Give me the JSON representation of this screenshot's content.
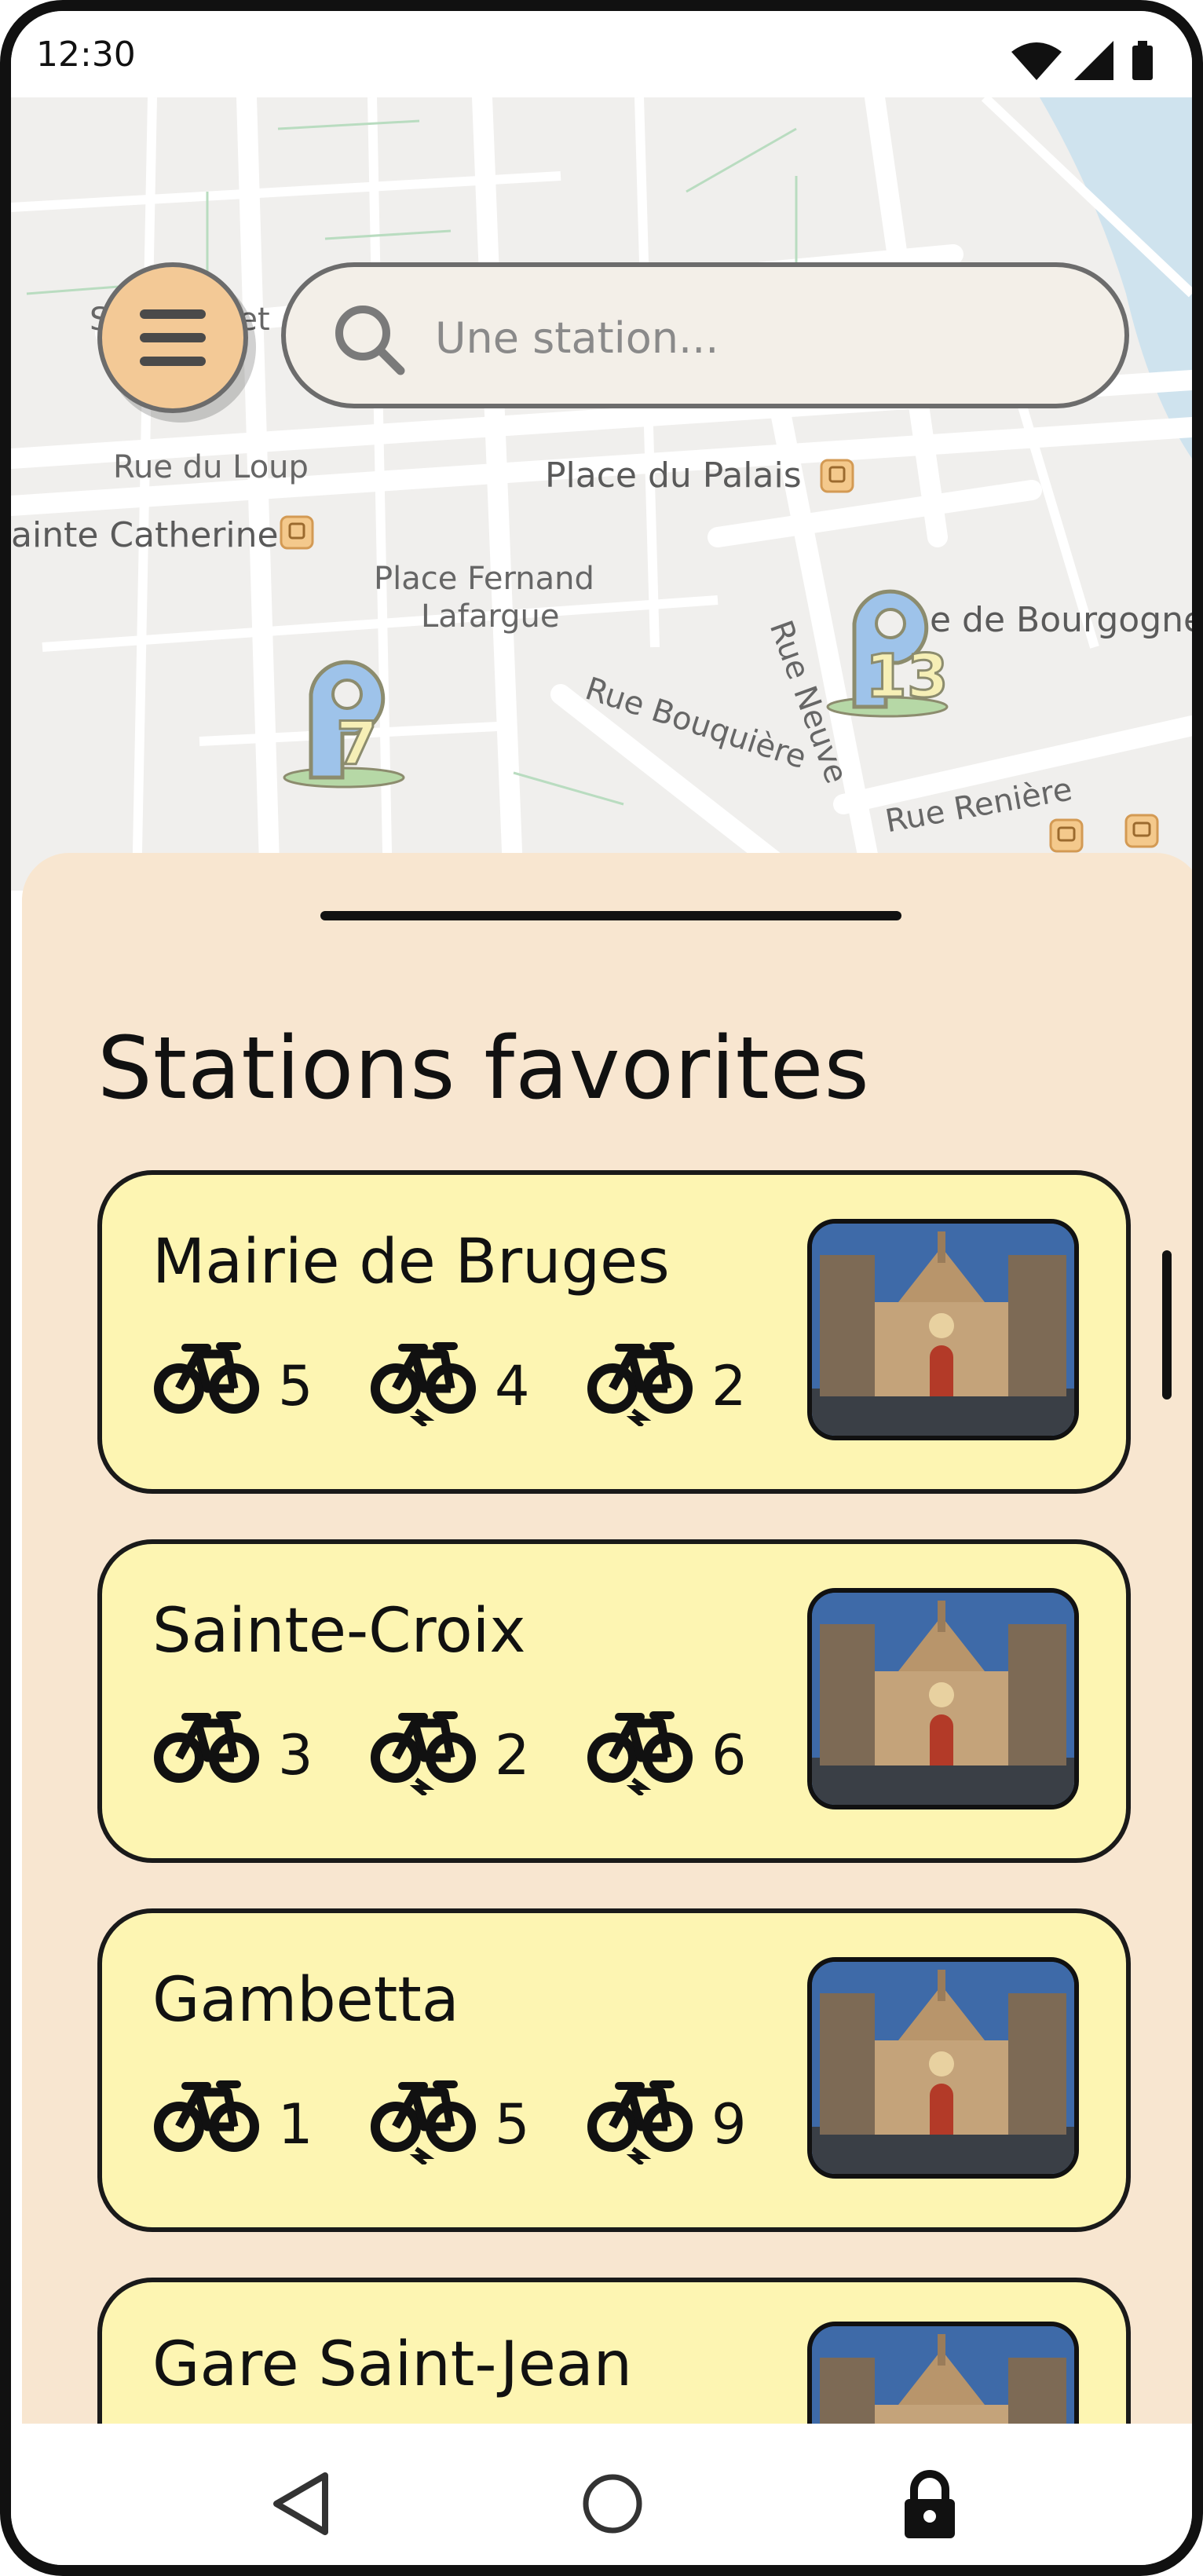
{
  "status_bar": {
    "time": "12:30"
  },
  "search": {
    "placeholder": "Une station..."
  },
  "map": {
    "labels": {
      "saint_projet": "Saint Projet",
      "rue_du_loup": "Rue du Loup",
      "place_du_palais": "Place du Palais",
      "sainte_catherine": "ainte Catherine",
      "place_fernand": "Place Fernand",
      "lafargue": "Lafargue",
      "rue_bouquiere": "Rue Bouquière",
      "rue_neuve": "Rue Neuve",
      "porte_bourgogne": "e de Bourgogne",
      "rue_reniere": "Rue Renière"
    },
    "markers": [
      {
        "count": "7"
      },
      {
        "count": "13"
      }
    ]
  },
  "sheet": {
    "title": "Stations favorites",
    "stations": [
      {
        "name": "Mairie de Bruges",
        "bikes": "5",
        "ebikes": "4",
        "docks": "2"
      },
      {
        "name": "Sainte-Croix",
        "bikes": "3",
        "ebikes": "2",
        "docks": "6"
      },
      {
        "name": "Gambetta",
        "bikes": "1",
        "ebikes": "5",
        "docks": "9"
      },
      {
        "name": "Gare Saint-Jean",
        "bikes": "",
        "ebikes": "",
        "docks": ""
      }
    ]
  },
  "colors": {
    "sheet_bg": "#f8e6d0",
    "card_bg": "#fdf5b2",
    "menu_button": "#f3c996",
    "search_bg": "#f3efe8",
    "marker_blue": "#9ec3ea"
  },
  "icons": {
    "menu": "hamburger-icon",
    "search": "search-icon",
    "bike": "bike-icon",
    "ebike": "ebike-icon",
    "nav_back": "back-triangle-icon",
    "nav_home": "home-circle-icon",
    "nav_lock": "lock-icon"
  }
}
